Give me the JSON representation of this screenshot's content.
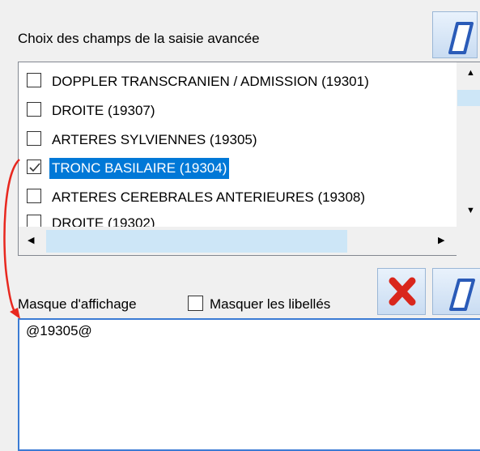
{
  "fields_panel": {
    "title": "Choix des champs de la saisie avancée",
    "items": [
      {
        "label": "DOPPLER TRANSCRANIEN / ADMISSION (19301)",
        "checked": false,
        "selected": false
      },
      {
        "label": "DROITE (19307)",
        "checked": false,
        "selected": false
      },
      {
        "label": "ARTERES SYLVIENNES (19305)",
        "checked": false,
        "selected": false
      },
      {
        "label": "TRONC BASILAIRE (19304)",
        "checked": true,
        "selected": true
      },
      {
        "label": "ARTERES CEREBRALES ANTERIEURES (19308)",
        "checked": false,
        "selected": false
      },
      {
        "label": "DROITE (19302)",
        "checked": false,
        "selected": false
      }
    ]
  },
  "mask_panel": {
    "title": "Masque d'affichage",
    "hide_labels_label": "Masquer les libellés",
    "hide_labels_checked": false,
    "value": "@19305@"
  },
  "colors": {
    "selection": "#0078d7",
    "mask_border": "#3b7bd4",
    "annotation_arrow": "#e8281f",
    "delete_icon": "#d9261c",
    "eraser_icon": "#2a5bb8"
  },
  "icons": {
    "top_clear": "eraser-icon",
    "delete": "red-x-icon",
    "bottom_clear": "eraser-icon"
  }
}
